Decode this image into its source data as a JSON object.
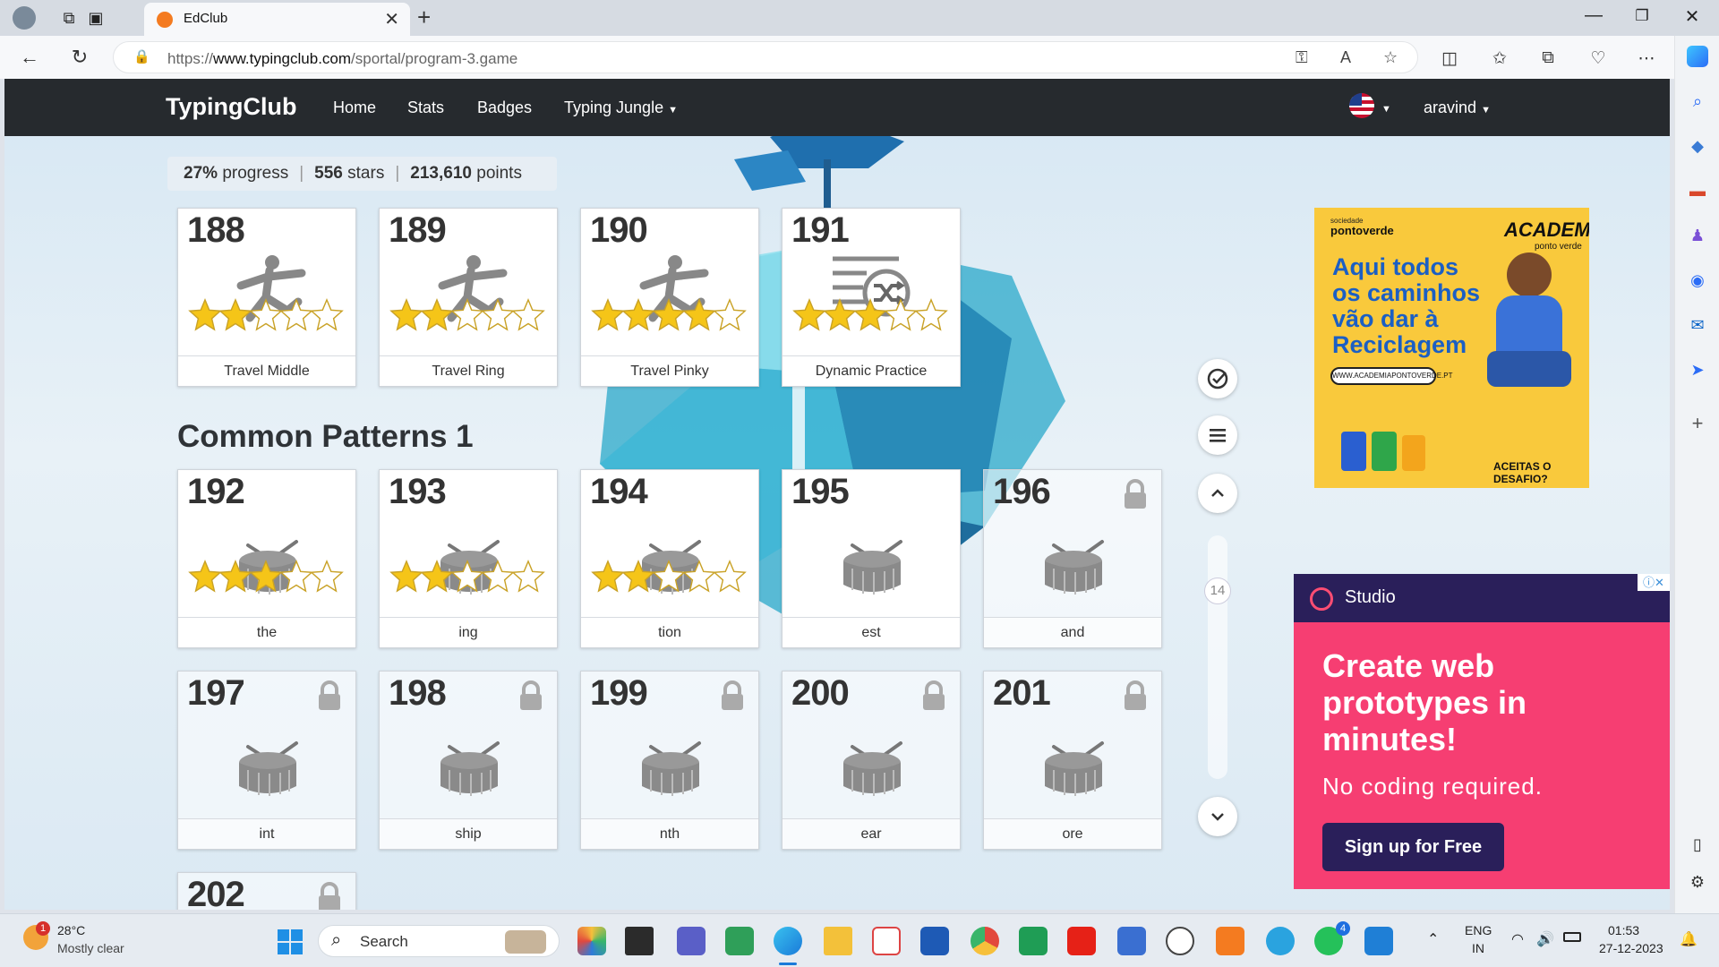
{
  "browser": {
    "tab_title": "EdClub",
    "url_prefix": "https://",
    "url_domain": "www.typingclub.com",
    "url_path": "/sportal/program-3.game"
  },
  "site": {
    "brand": "TypingClub",
    "nav": [
      "Home",
      "Stats",
      "Badges",
      "Typing Jungle"
    ],
    "user": "aravind"
  },
  "progress": {
    "percent": "27%",
    "percent_label": "progress",
    "stars": "556",
    "stars_label": "stars",
    "points": "213,610",
    "points_label": "points"
  },
  "top_row": [
    {
      "num": "188",
      "label": "Travel Middle",
      "stars": 2
    },
    {
      "num": "189",
      "label": "Travel Ring",
      "stars": 2
    },
    {
      "num": "190",
      "label": "Travel Pinky",
      "stars": 4
    },
    {
      "num": "191",
      "label": "Dynamic Practice",
      "stars": 3
    }
  ],
  "section_title": "Common Patterns 1",
  "row1": [
    {
      "num": "192",
      "label": "the",
      "stars": 3,
      "locked": false
    },
    {
      "num": "193",
      "label": "ing",
      "stars": 2,
      "locked": false
    },
    {
      "num": "194",
      "label": "tion",
      "stars": 2,
      "locked": false
    },
    {
      "num": "195",
      "label": "est",
      "stars": 0,
      "locked": false
    },
    {
      "num": "196",
      "label": "and",
      "stars": 0,
      "locked": true
    }
  ],
  "row2": [
    {
      "num": "197",
      "label": "int",
      "locked": true
    },
    {
      "num": "198",
      "label": "ship",
      "locked": true
    },
    {
      "num": "199",
      "label": "nth",
      "locked": true
    },
    {
      "num": "200",
      "label": "ear",
      "locked": true
    },
    {
      "num": "201",
      "label": "ore",
      "locked": true
    }
  ],
  "row3": [
    {
      "num": "202",
      "locked": true
    }
  ],
  "scroll_page_number": "14",
  "ad_academia": {
    "brand_small": "sociedade",
    "brand": "pontoverde",
    "title": "ACADEMIA",
    "title_sub": "ponto verde",
    "headline": [
      "Aqui todos",
      "os caminhos",
      "vão dar à",
      "Reciclagem"
    ],
    "url": "WWW.ACADEMIAPONTOVERDE.PT",
    "cta": "ACEITAS O DESAFIO?"
  },
  "ad_studio": {
    "brand": "Studio",
    "headline": "Create web prototypes in minutes!",
    "sub": "No coding required.",
    "cta": "Sign up for Free"
  },
  "taskbar": {
    "weather_temp": "28°C",
    "weather_desc": "Mostly clear",
    "weather_badge": "1",
    "search_placeholder": "Search",
    "whatsapp_badge": "4",
    "lang_line1": "ENG",
    "lang_line2": "IN",
    "time": "01:53",
    "date": "27-12-2023"
  },
  "colors": {
    "navbar": "#262a2e",
    "star_gold": "#f5c518",
    "ad_pink": "#f63e72",
    "ad_navy": "#2a1f5a",
    "ad_yellow": "#f9c93c"
  }
}
